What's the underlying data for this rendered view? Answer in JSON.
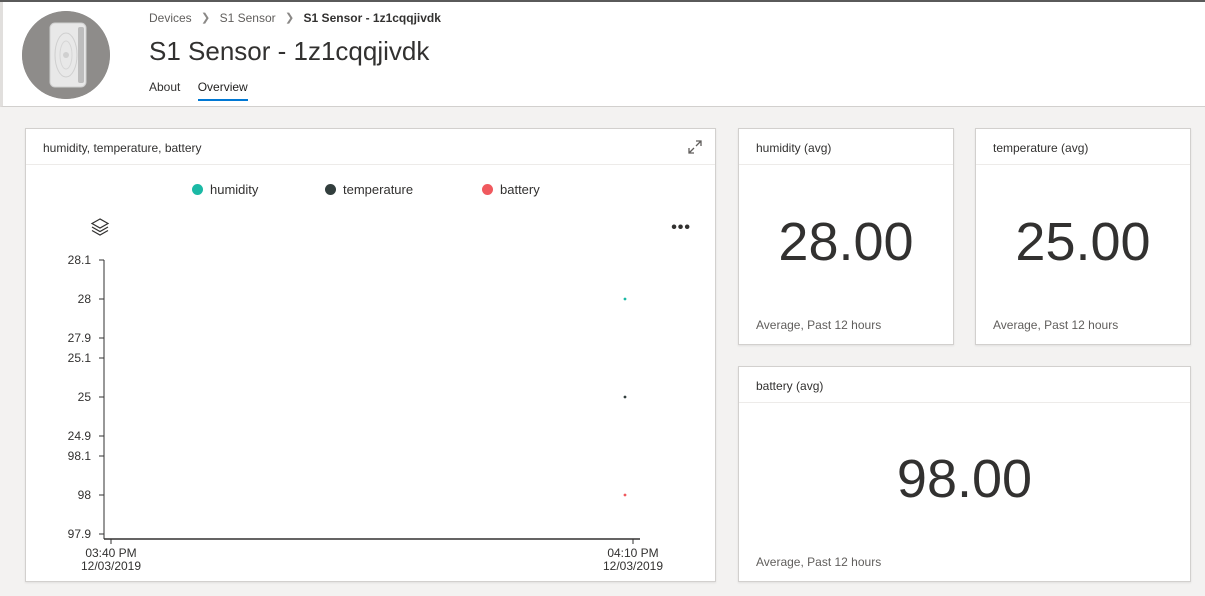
{
  "breadcrumb": [
    {
      "label": "Devices"
    },
    {
      "label": "S1 Sensor"
    },
    {
      "label": "S1 Sensor - 1z1cqqjivdk"
    }
  ],
  "page_title": "S1 Sensor - 1z1cqqjivdk",
  "tabs": [
    {
      "label": "About",
      "active": false
    },
    {
      "label": "Overview",
      "active": true
    }
  ],
  "line_card": {
    "title": "humidity, temperature, battery",
    "legend": [
      {
        "label": "humidity",
        "color": "#1bb9a5"
      },
      {
        "label": "temperature",
        "color": "#323e3d"
      },
      {
        "label": "battery",
        "color": "#f0595e"
      }
    ]
  },
  "kpis": {
    "humidity": {
      "title": "humidity (avg)",
      "value": "28.00",
      "footer": "Average, Past 12 hours"
    },
    "temperature": {
      "title": "temperature (avg)",
      "value": "25.00",
      "footer": "Average, Past 12 hours"
    },
    "battery": {
      "title": "battery (avg)",
      "value": "98.00",
      "footer": "Average, Past 12 hours"
    }
  },
  "chart_data": {
    "type": "line",
    "title": "humidity, temperature, battery",
    "x_ticks": [
      {
        "time": "03:40 PM",
        "date": "12/03/2019"
      },
      {
        "time": "04:10 PM",
        "date": "12/03/2019"
      }
    ],
    "series": [
      {
        "name": "humidity",
        "color": "#1bb9a5",
        "y_ticks": [
          "28.1",
          "28",
          "27.9"
        ],
        "ylim": [
          27.9,
          28.1
        ],
        "points": [
          {
            "x": "04:08 PM",
            "y": 28
          }
        ]
      },
      {
        "name": "temperature",
        "color": "#323e3d",
        "y_ticks": [
          "25.1",
          "25",
          "24.9"
        ],
        "ylim": [
          24.9,
          25.1
        ],
        "points": [
          {
            "x": "04:08 PM",
            "y": 25
          }
        ]
      },
      {
        "name": "battery",
        "color": "#f0595e",
        "y_ticks": [
          "98.1",
          "98",
          "97.9"
        ],
        "ylim": [
          97.9,
          98.1
        ],
        "points": [
          {
            "x": "04:08 PM",
            "y": 98
          }
        ]
      }
    ],
    "legend_position": "top",
    "grid": false
  },
  "icons": {
    "expand": "expand-icon",
    "layers": "layers-icon",
    "more": "more-icon",
    "chevron": "chevron-right-icon"
  }
}
